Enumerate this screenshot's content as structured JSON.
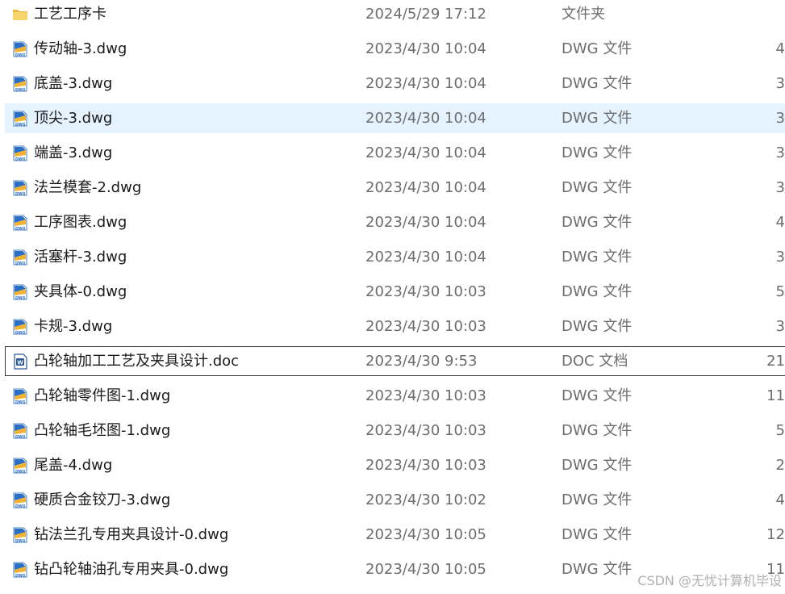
{
  "rows": [
    {
      "name": "工艺工序卡",
      "date": "2024/5/29 17:12",
      "type": "文件夹",
      "size": "",
      "icon": "folder-icon"
    },
    {
      "name": "传动轴-3.dwg",
      "date": "2023/4/30 10:04",
      "type": "DWG 文件",
      "size": "4",
      "icon": "dwg-file-icon"
    },
    {
      "name": "底盖-3.dwg",
      "date": "2023/4/30 10:04",
      "type": "DWG 文件",
      "size": "3",
      "icon": "dwg-file-icon"
    },
    {
      "name": "顶尖-3.dwg",
      "date": "2023/4/30 10:04",
      "type": "DWG 文件",
      "size": "3",
      "icon": "dwg-file-icon",
      "hovered": true
    },
    {
      "name": "端盖-3.dwg",
      "date": "2023/4/30 10:04",
      "type": "DWG 文件",
      "size": "3",
      "icon": "dwg-file-icon"
    },
    {
      "name": "法兰模套-2.dwg",
      "date": "2023/4/30 10:04",
      "type": "DWG 文件",
      "size": "3",
      "icon": "dwg-file-icon"
    },
    {
      "name": "工序图表.dwg",
      "date": "2023/4/30 10:04",
      "type": "DWG 文件",
      "size": "4",
      "icon": "dwg-file-icon"
    },
    {
      "name": "活塞杆-3.dwg",
      "date": "2023/4/30 10:04",
      "type": "DWG 文件",
      "size": "3",
      "icon": "dwg-file-icon"
    },
    {
      "name": "夹具体-0.dwg",
      "date": "2023/4/30 10:03",
      "type": "DWG 文件",
      "size": "5",
      "icon": "dwg-file-icon"
    },
    {
      "name": "卡规-3.dwg",
      "date": "2023/4/30 10:03",
      "type": "DWG 文件",
      "size": "3",
      "icon": "dwg-file-icon"
    },
    {
      "name": "凸轮轴加工工艺及夹具设计.doc",
      "date": "2023/4/30 9:53",
      "type": "DOC 文档",
      "size": "21",
      "icon": "word-doc-icon",
      "focused": true
    },
    {
      "name": "凸轮轴零件图-1.dwg",
      "date": "2023/4/30 10:03",
      "type": "DWG 文件",
      "size": "11",
      "icon": "dwg-file-icon"
    },
    {
      "name": "凸轮轴毛坯图-1.dwg",
      "date": "2023/4/30 10:03",
      "type": "DWG 文件",
      "size": "5",
      "icon": "dwg-file-icon"
    },
    {
      "name": "尾盖-4.dwg",
      "date": "2023/4/30 10:03",
      "type": "DWG 文件",
      "size": "2",
      "icon": "dwg-file-icon"
    },
    {
      "name": "硬质合金铰刀-3.dwg",
      "date": "2023/4/30 10:02",
      "type": "DWG 文件",
      "size": "4",
      "icon": "dwg-file-icon"
    },
    {
      "name": "钻法兰孔专用夹具设计-0.dwg",
      "date": "2023/4/30 10:05",
      "type": "DWG 文件",
      "size": "12",
      "icon": "dwg-file-icon"
    },
    {
      "name": "钻凸轮轴油孔专用夹具-0.dwg",
      "date": "2023/4/30 10:05",
      "type": "DWG 文件",
      "size": "11",
      "icon": "dwg-file-icon"
    }
  ],
  "watermark": "CSDN @无忧计算机毕设",
  "colors": {
    "hover_bg": "#e5f3ff",
    "focus_border": "#333333",
    "folder": "#f8d56a",
    "dwg_blue": "#2a6fc4",
    "dwg_gold": "#f2b233",
    "word_blue": "#2b579a"
  }
}
